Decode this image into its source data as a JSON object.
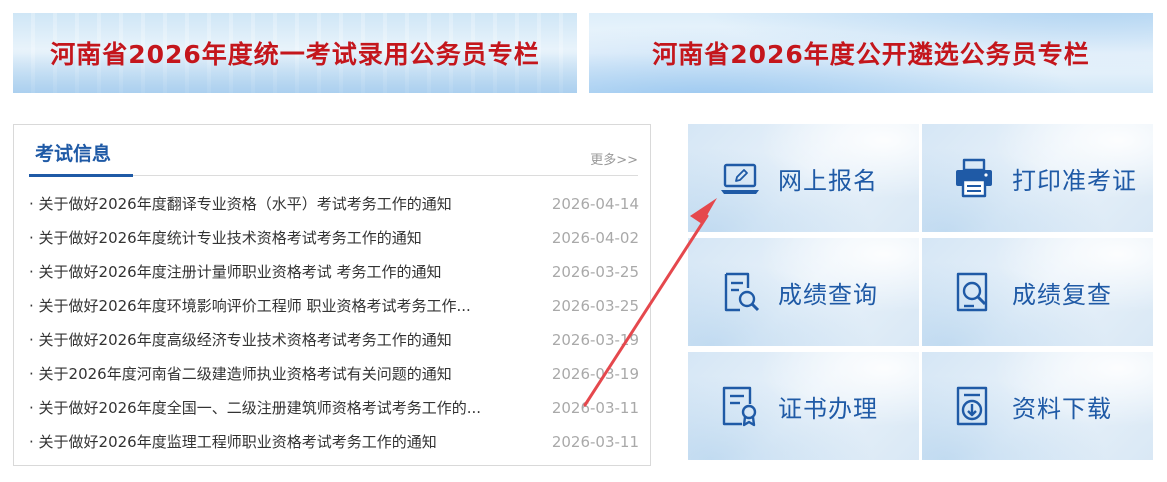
{
  "banners": {
    "left": "河南省2026年度统一考试录用公务员专栏",
    "right": "河南省2026年度公开遴选公务员专栏"
  },
  "news": {
    "title": "考试信息",
    "more": "更多>>",
    "items": [
      {
        "title": "· 关于做好2026年度翻译专业资格（水平）考试考务工作的通知",
        "date": "2026-04-14"
      },
      {
        "title": "· 关于做好2026年度统计专业技术资格考试考务工作的通知",
        "date": "2026-04-02"
      },
      {
        "title": "· 关于做好2026年度注册计量师职业资格考试 考务工作的通知",
        "date": "2026-03-25"
      },
      {
        "title": "· 关于做好2026年度环境影响评价工程师 职业资格考试考务工作...",
        "date": "2026-03-25"
      },
      {
        "title": "· 关于做好2026年度高级经济专业技术资格考试考务工作的通知",
        "date": "2026-03-19"
      },
      {
        "title": "· 关于2026年度河南省二级建造师执业资格考试有关问题的通知",
        "date": "2026-03-19"
      },
      {
        "title": "· 关于做好2026年度全国一、二级注册建筑师资格考试考务工作的...",
        "date": "2026-03-11"
      },
      {
        "title": "· 关于做好2026年度监理工程师职业资格考试考务工作的通知",
        "date": "2026-03-11"
      }
    ]
  },
  "tiles": [
    {
      "label": "网上报名",
      "icon": "laptop-edit-icon"
    },
    {
      "label": "打印准考证",
      "icon": "printer-icon"
    },
    {
      "label": "成绩查询",
      "icon": "document-search-icon"
    },
    {
      "label": "成绩复查",
      "icon": "document-magnify-icon"
    },
    {
      "label": "证书办理",
      "icon": "certificate-icon"
    },
    {
      "label": "资料下载",
      "icon": "document-download-icon"
    }
  ],
  "colors": {
    "accent_blue": "#1f5aa6",
    "banner_red": "#c4161c",
    "annotation_arrow": "#e5484d",
    "date_gray": "#a9a9a9"
  }
}
